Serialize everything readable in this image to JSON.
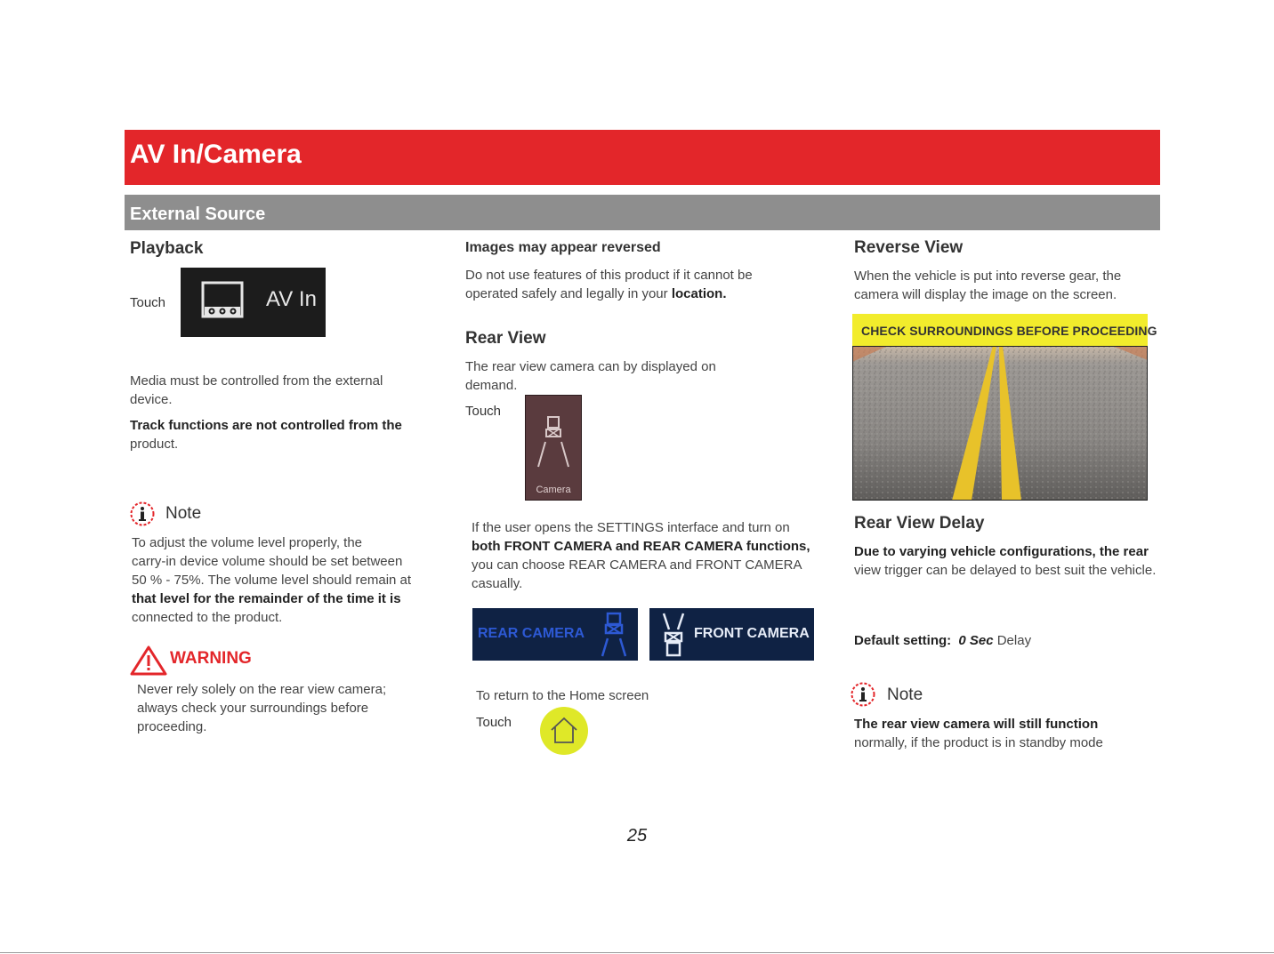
{
  "header": {
    "title": "AV In/Camera",
    "subtitle": "External Source",
    "red": "#e3262a",
    "gray": "#8e8e8e"
  },
  "col1": {
    "heading": "Playback",
    "touch_label": "Touch",
    "avin_button_label": "AV In",
    "media_text": "Media must be controlled from the external device.",
    "track_bold": "Track functions are not controlled from the",
    "track_rest": "product.",
    "note_title": "Note",
    "note_line1": "To adjust the volume level properly, the",
    "note_line2": "carry-in device volume should be set between",
    "note_line3": "50 % - 75%. The volume level should remain at",
    "note_bold": "that level for the remainder of the time it is",
    "note_line5": "connected to the product.",
    "warning_title": "WARNING",
    "warning_text": "Never rely solely on the rear view camera; always check your surroundings before proceeding."
  },
  "col2": {
    "heading": "Images may appear reversed",
    "para1": "Do not use features of this product if it cannot be operated safely and legally in your",
    "para1_bold": "location.",
    "rear_view_heading": "Rear View",
    "rear_view_text": "The rear view camera can by displayed on demand.",
    "touch_label": "Touch",
    "camera_button_label": "Camera",
    "settings_line1": "If the user opens the SETTINGS interface and turn on",
    "settings_bold": "both FRONT CAMERA and REAR CAMERA functions,",
    "settings_line3": "you can choose  REAR CAMERA and FRONT CAMERA casually.",
    "rear_camera_label": "REAR CAMERA",
    "front_camera_label": "FRONT CAMERA",
    "return_text": "To return to the Home screen",
    "touch_label2": "Touch"
  },
  "col3": {
    "heading": "Reverse View",
    "reverse_text": "When the vehicle is put into reverse gear, the camera will display the image on the screen.",
    "check_banner": "CHECK SURROUNDINGS BEFORE PROCEEDING",
    "delay_heading": "Rear View Delay",
    "delay_bold": "Due to varying vehicle configurations, the rear",
    "delay_rest": "view trigger can be delayed to best suit the vehicle.",
    "default_label": "Default setting:",
    "default_value": "0 Sec",
    "default_unit": "Delay",
    "note_title": "Note",
    "note_bold": "The rear view camera will still function",
    "note_rest": "normally, if the product is in standby mode"
  },
  "page_number": "25"
}
